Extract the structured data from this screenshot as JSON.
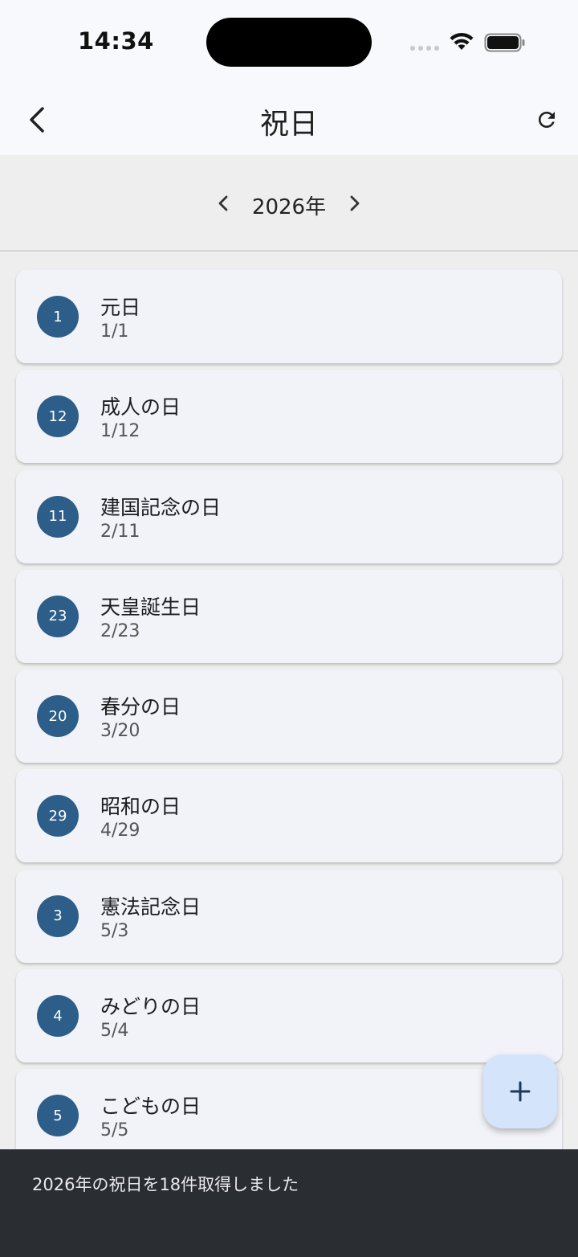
{
  "status_bar": {
    "time": "14:34"
  },
  "app_bar": {
    "title": "祝日"
  },
  "year_nav": {
    "year_label": "2026年"
  },
  "holidays": [
    {
      "day": "1",
      "name": "元日",
      "date": "1/1"
    },
    {
      "day": "12",
      "name": "成人の日",
      "date": "1/12"
    },
    {
      "day": "11",
      "name": "建国記念の日",
      "date": "2/11"
    },
    {
      "day": "23",
      "name": "天皇誕生日",
      "date": "2/23"
    },
    {
      "day": "20",
      "name": "春分の日",
      "date": "3/20"
    },
    {
      "day": "29",
      "name": "昭和の日",
      "date": "4/29"
    },
    {
      "day": "3",
      "name": "憲法記念日",
      "date": "5/3"
    },
    {
      "day": "4",
      "name": "みどりの日",
      "date": "5/4"
    },
    {
      "day": "5",
      "name": "こどもの日",
      "date": "5/5"
    }
  ],
  "snackbar": {
    "message": "2026年の祝日を18件取得しました"
  },
  "icons": {
    "back": "arrow-back-icon",
    "refresh": "refresh-icon",
    "prev": "chevron-left-icon",
    "next": "chevron-right-icon",
    "add": "plus-icon"
  },
  "colors": {
    "avatar_bg": "#2d5e89",
    "fab_bg": "#d3e4fb",
    "snackbar_bg": "#2a2d31"
  }
}
